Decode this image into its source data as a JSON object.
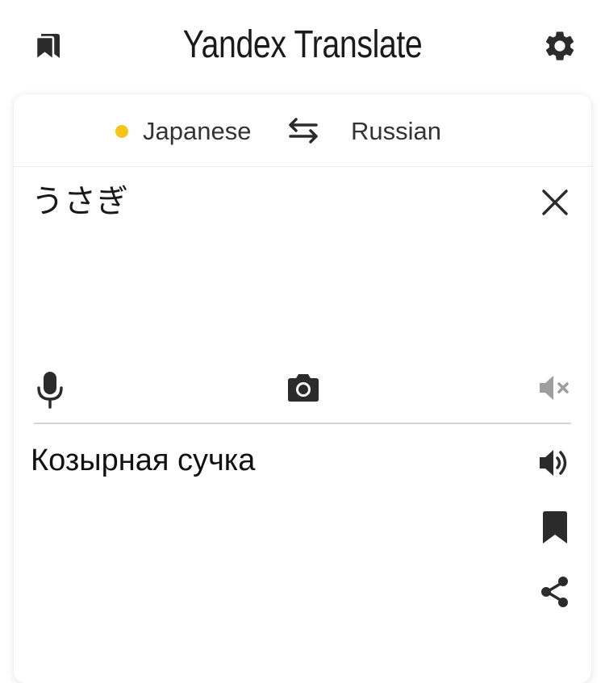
{
  "header": {
    "brand": "Yandex",
    "product": "Translate",
    "bookmarks_icon": "bookmarks-icon",
    "settings_icon": "gear-icon"
  },
  "languages": {
    "source": "Japanese",
    "target": "Russian",
    "source_indicator_color": "#f5c518",
    "swap_icon": "swap-arrows-icon"
  },
  "input": {
    "text": "うさぎ",
    "clear_icon": "close-icon",
    "mic_icon": "microphone-icon",
    "camera_icon": "camera-icon",
    "mute_icon": "speaker-muted-icon"
  },
  "output": {
    "text": "Козырная сучка",
    "speak_icon": "speaker-icon",
    "save_icon": "bookmark-icon",
    "share_icon": "share-icon"
  },
  "colors": {
    "accent_dot": "#f5c518",
    "icon": "#2b2b2b",
    "muted_icon": "#9e9e9e"
  }
}
